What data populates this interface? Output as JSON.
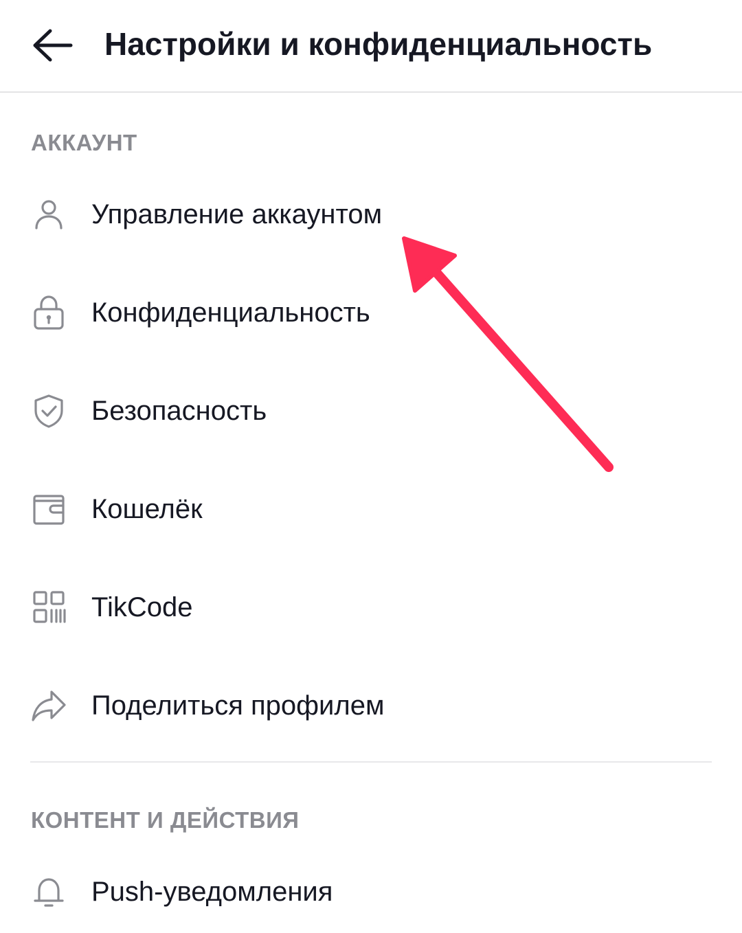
{
  "header": {
    "title": "Настройки и конфиденциальность"
  },
  "sections": [
    {
      "title": "АККАУНТ",
      "items": [
        {
          "label": "Управление аккаунтом",
          "icon": "person-icon"
        },
        {
          "label": "Конфиденциальность",
          "icon": "lock-icon"
        },
        {
          "label": "Безопасность",
          "icon": "shield-icon"
        },
        {
          "label": "Кошелёк",
          "icon": "wallet-icon"
        },
        {
          "label": "TikCode",
          "icon": "qr-code-icon"
        },
        {
          "label": "Поделиться профилем",
          "icon": "share-icon"
        }
      ]
    },
    {
      "title": "КОНТЕНТ И ДЕЙСТВИЯ",
      "items": [
        {
          "label": "Push-уведомления",
          "icon": "bell-icon"
        }
      ]
    }
  ],
  "colors": {
    "text": "#161823",
    "muted": "#8a8b91",
    "divider": "#e3e3e5",
    "annotation_arrow": "#fe2c55"
  }
}
